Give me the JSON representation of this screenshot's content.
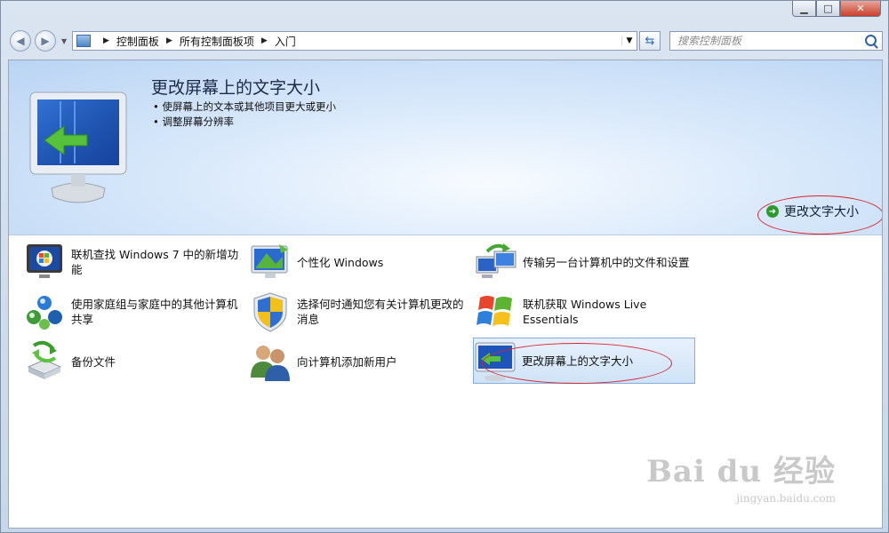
{
  "window": {
    "caption": {
      "minimize": "▁",
      "maximize": "□",
      "close": "✕"
    }
  },
  "nav": {
    "breadcrumb": [
      "控制面板",
      "所有控制面板项",
      "入门"
    ],
    "search_placeholder": "搜索控制面板"
  },
  "banner": {
    "title": "更改屏幕上的文字大小",
    "bullets": [
      "使屏幕上的文本或其他项目更大或更小",
      "调整屏幕分辨率"
    ],
    "action_label": "更改文字大小"
  },
  "tasks": [
    {
      "label": "联机查找 Windows 7 中的新增功能",
      "icon": "windows-new-features-icon"
    },
    {
      "label": "个性化 Windows",
      "icon": "personalize-monitor-icon"
    },
    {
      "label": "传输另一台计算机中的文件和设置",
      "icon": "transfer-computers-icon"
    },
    {
      "label": "使用家庭组与家庭中的其他计算机共享",
      "icon": "homegroup-icon"
    },
    {
      "label": "选择何时通知您有关计算机更改的消息",
      "icon": "uac-shield-icon"
    },
    {
      "label": "联机获取 Windows Live Essentials",
      "icon": "windows-logo-icon"
    },
    {
      "label": "备份文件",
      "icon": "backup-drive-icon"
    },
    {
      "label": "向计算机添加新用户",
      "icon": "add-user-icon"
    },
    {
      "label": "更改屏幕上的文字大小",
      "icon": "monitor-text-size-icon",
      "selected": true
    }
  ],
  "watermark": {
    "text": "Bai du 经验",
    "url": "jingyan.baidu.com"
  },
  "colors": {
    "annotation_red": "#d8242e",
    "selection_blue": "#84acdd"
  }
}
